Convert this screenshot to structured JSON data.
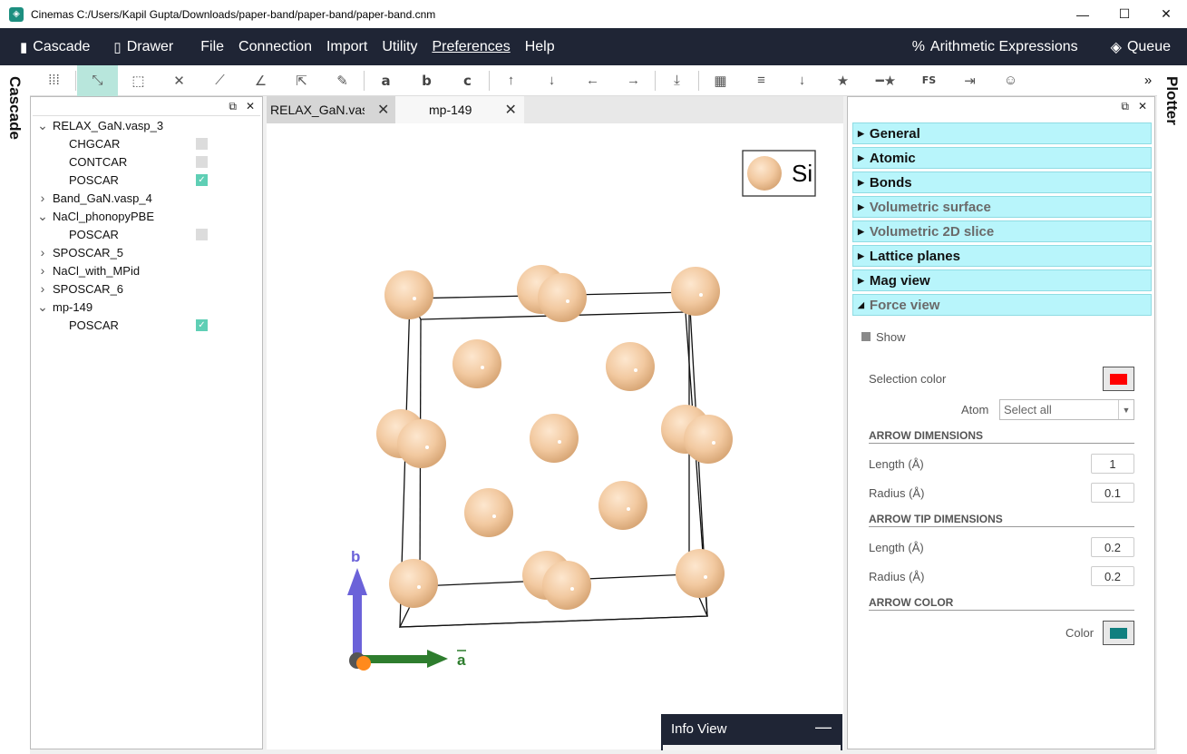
{
  "window": {
    "title": "Cinemas C:/Users/Kapil Gupta/Downloads/paper-band/paper-band/paper-band.cnm",
    "minimize": "—",
    "maximize": "☐",
    "close": "✕"
  },
  "menu": {
    "cascade": "Cascade",
    "drawer": "Drawer",
    "items": [
      "File",
      "Connection",
      "Import",
      "Utility",
      "Preferences",
      "Help"
    ],
    "arithmetic": "Arithmetic Expressions",
    "queue": "Queue"
  },
  "side_tabs": {
    "left": "Cascade",
    "right": "Plotter"
  },
  "toolbar": {
    "letters": [
      "a",
      "b",
      "c"
    ],
    "fs": "FS",
    "more": "»"
  },
  "tree": {
    "items": [
      {
        "label": "RELAX_GaN.vasp_3",
        "expanded": true
      },
      {
        "label": "CHGCAR",
        "checked": false
      },
      {
        "label": "CONTCAR",
        "checked": false
      },
      {
        "label": "POSCAR",
        "checked": true
      },
      {
        "label": "Band_GaN.vasp_4",
        "expanded": false
      },
      {
        "label": "NaCl_phonopyPBE",
        "expanded": true
      },
      {
        "label": "POSCAR",
        "checked": false
      },
      {
        "label": "SPOSCAR_5",
        "expanded": false
      },
      {
        "label": "NaCl_with_MPid",
        "expanded": false
      },
      {
        "label": "SPOSCAR_6",
        "expanded": false
      },
      {
        "label": "mp-149",
        "expanded": true
      },
      {
        "label": "POSCAR",
        "checked": true
      }
    ]
  },
  "tabs": [
    {
      "label": "RELAX_GaN.vasp_"
    },
    {
      "label": "mp-149"
    }
  ],
  "viewer": {
    "legend_element": "Si",
    "axis_b": "b",
    "axis_a": "a",
    "atom_color": "#f2c9a0"
  },
  "info_view": {
    "label": "Info View",
    "minimize": "—"
  },
  "properties": {
    "sections": [
      "General",
      "Atomic",
      "Bonds",
      "Volumetric surface",
      "Volumetric 2D slice",
      "Lattice planes",
      "Mag view",
      "Force view"
    ],
    "force_view": {
      "show": "Show",
      "selection_color_label": "Selection color",
      "selection_color": "#ff0000",
      "atom_label": "Atom",
      "atom_select": "Select all",
      "arrow_dimensions": "ARROW DIMENSIONS",
      "length_label": "Length (Å)",
      "length": "1",
      "radius_label": "Radius (Å)",
      "radius": "0.1",
      "arrow_tip_dimensions": "ARROW TIP DIMENSIONS",
      "tip_length_label": "Length (Å)",
      "tip_length": "0.2",
      "tip_radius_label": "Radius (Å)",
      "tip_radius": "0.2",
      "arrow_color": "ARROW COLOR",
      "color_label": "Color",
      "color": "#117f7f"
    }
  }
}
